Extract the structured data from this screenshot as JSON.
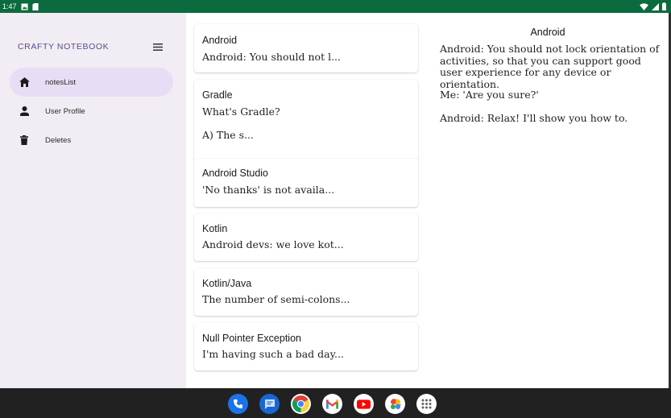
{
  "status_bar": {
    "time": "1:47"
  },
  "drawer": {
    "app_title": "CRAFTY NOTEBOOK",
    "items": [
      {
        "label": "notesList",
        "icon": "home-icon",
        "active": true
      },
      {
        "label": "User Profile",
        "icon": "person-icon",
        "active": false
      },
      {
        "label": "Deletes",
        "icon": "trash-icon",
        "active": false
      }
    ]
  },
  "notes": [
    {
      "title": "Android",
      "preview": "Android: You should not l..."
    },
    {
      "title": "Gradle",
      "preview": "What's Gradle?",
      "preview2": "A) The s..."
    },
    {
      "title": "Android Studio",
      "preview": "'No thanks' is not availa..."
    },
    {
      "title": "Kotlin",
      "preview": "Android devs: we love kot..."
    },
    {
      "title": "Kotlin/Java",
      "preview": "The number of semi-colons..."
    },
    {
      "title": "Null Pointer Exception",
      "preview": "I'm having such a bad day..."
    }
  ],
  "detail": {
    "title": "Android",
    "paragraphs": [
      "Android: You should not lock orientation of activities, so that you can support good  user experience for any device or orientation.",
      "Me: 'Are you sure?'",
      "Android: Relax! I'll show you how to."
    ]
  },
  "dock": [
    {
      "app": "phone",
      "icon": "phone-icon",
      "color": "#1a73e8"
    },
    {
      "app": "messages",
      "icon": "messages-icon",
      "color": "#1967d2"
    },
    {
      "app": "chrome",
      "icon": "chrome-icon",
      "color": "#ffffff"
    },
    {
      "app": "gmail",
      "icon": "gmail-icon",
      "color": "#ffffff"
    },
    {
      "app": "youtube",
      "icon": "youtube-icon",
      "color": "#ff0000"
    },
    {
      "app": "photos",
      "icon": "photos-icon",
      "color": "#ffffff"
    },
    {
      "app": "app-drawer",
      "icon": "apps-grid-icon",
      "color": "#ffffff"
    }
  ]
}
